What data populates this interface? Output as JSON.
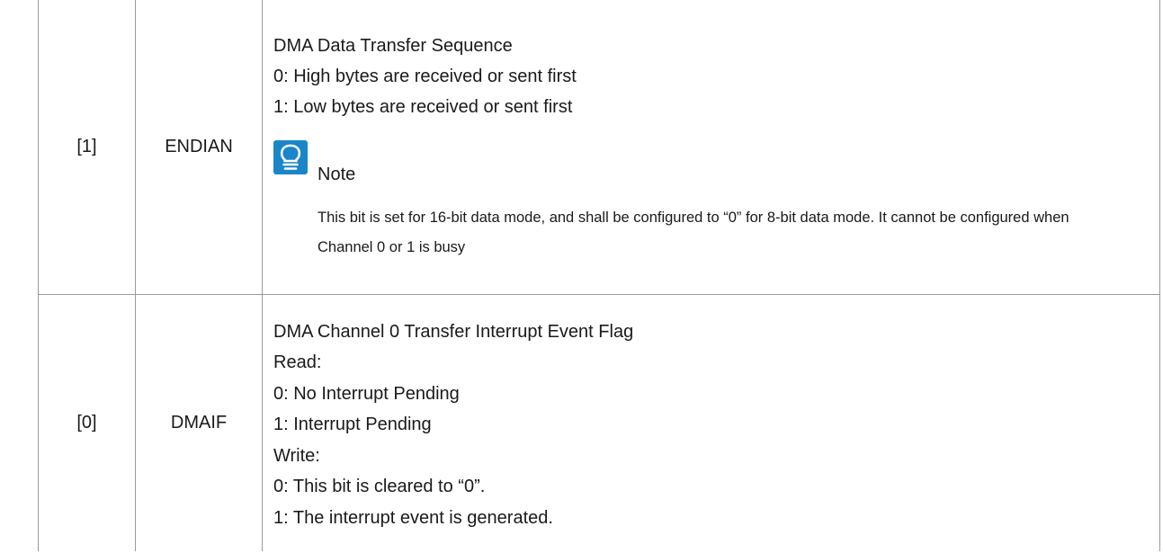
{
  "rows": [
    {
      "bit": "[1]",
      "name": "ENDIAN",
      "description": [
        "DMA Data Transfer Sequence",
        "0: High bytes are received or sent first",
        "1: Low bytes are received or sent first"
      ],
      "note": {
        "icon": "lightbulb-icon",
        "title": "Note",
        "text": "This bit is set for 16-bit data mode, and shall be configured to “0” for 8-bit data mode. It cannot be configured when Channel 0 or 1 is busy"
      }
    },
    {
      "bit": "[0]",
      "name": "DMAIF",
      "description": [
        "DMA Channel 0 Transfer Interrupt Event Flag",
        "Read:",
        "0: No Interrupt Pending",
        "1: Interrupt Pending",
        "Write:",
        "0: This bit is cleared to “0”.",
        "1: The interrupt event is generated."
      ]
    }
  ],
  "colors": {
    "border": "#9a9a9a",
    "note_icon": "#1a86c8",
    "text": "#1a1a1a"
  }
}
